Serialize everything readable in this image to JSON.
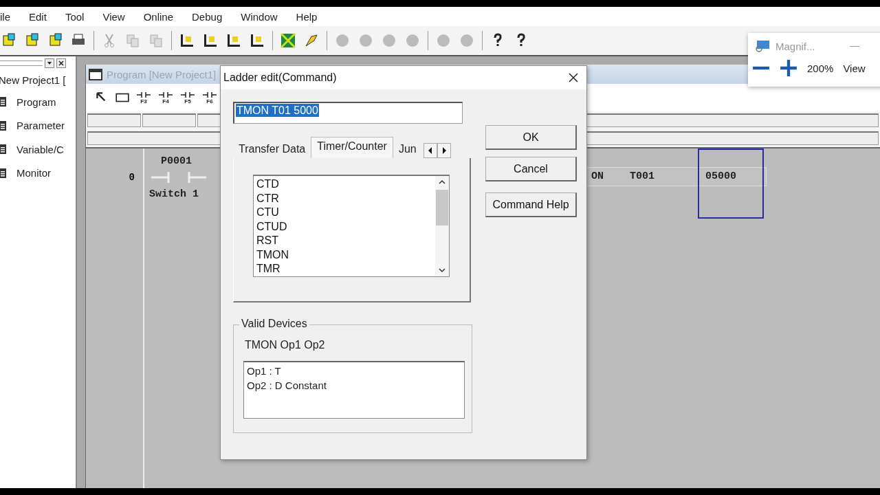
{
  "menu": [
    "ile",
    "Edit",
    "Tool",
    "View",
    "Online",
    "Debug",
    "Window",
    "Help"
  ],
  "project_panel": {
    "title": "New Project1 [",
    "items": [
      {
        "label": "Program"
      },
      {
        "label": "Parameter"
      },
      {
        "label": "Variable/C"
      },
      {
        "label": "Monitor"
      }
    ]
  },
  "program_window": {
    "title": "Program [New Project1]",
    "tool_keys": [
      "F3",
      "F4",
      "F5",
      "F6"
    ],
    "rung": {
      "number": "0",
      "contact": "P0001",
      "comment": "Switch 1",
      "instruction": "ON",
      "operand": "T001",
      "value": "05000"
    }
  },
  "dialog": {
    "title": "Ladder edit(Command)",
    "command": {
      "value": "TMON T01 5000",
      "selected": true
    },
    "tabs": [
      {
        "label": "Transfer Data",
        "selected": false
      },
      {
        "label": "Timer/Counter",
        "selected": true
      },
      {
        "label": "Jun",
        "selected": false
      }
    ],
    "list": [
      "CTD",
      "CTR",
      "CTU",
      "CTUD",
      "RST",
      "TMON",
      "TMR"
    ],
    "buttons": [
      "OK",
      "Cancel",
      "Command Help"
    ],
    "valid_devices": {
      "legend": "Valid Devices",
      "syntax": "TMON Op1 Op2",
      "operands": [
        "Op1 : T",
        "Op2 : D Constant"
      ]
    }
  },
  "magnifier": {
    "title": "Magnif...",
    "zoom": "200%",
    "views": "View"
  }
}
